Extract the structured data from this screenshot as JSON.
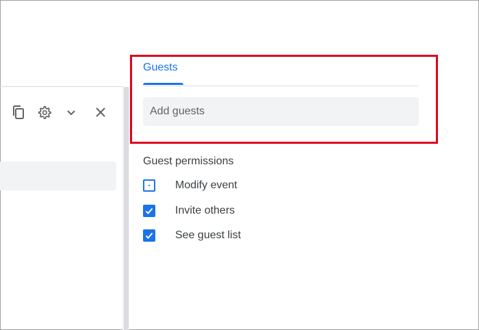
{
  "toolbar": {
    "icons": [
      "copy-icon",
      "gear-icon",
      "chevron-down-icon",
      "close-icon"
    ]
  },
  "tabs": {
    "guests_label": "Guests"
  },
  "guests": {
    "input_placeholder": "Add guests",
    "input_value": ""
  },
  "permissions": {
    "heading": "Guest permissions",
    "items": [
      {
        "label": "Modify event",
        "checked": false
      },
      {
        "label": "Invite others",
        "checked": true
      },
      {
        "label": "See guest list",
        "checked": true
      }
    ]
  },
  "colors": {
    "accent": "#1a73e8",
    "highlight": "#e0001b",
    "field_bg": "#f1f3f4"
  }
}
